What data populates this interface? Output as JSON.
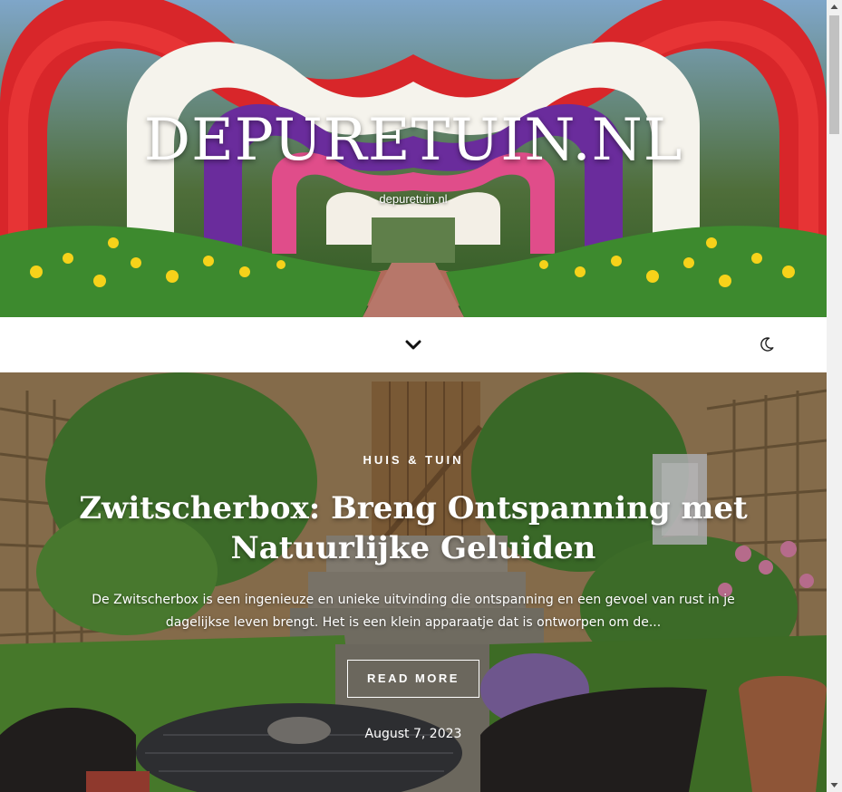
{
  "header": {
    "site_title": "DEPURETUIN.NL",
    "tagline": "depuretuin.nl"
  },
  "nav": {
    "menu_icon": "chevron-down-icon",
    "theme_icon": "moon-icon"
  },
  "featured_post": {
    "category": "HUIS & TUIN",
    "title": "Zwitscherbox: Breng Ontspanning met Natuurlijke Geluiden",
    "excerpt": "De Zwitscherbox is een ingenieuze en unieke uitvinding die ontspanning en een gevoel van rust in je dagelijkse leven brengt. Het is een klein apparaatje dat is ontworpen om de...",
    "read_more_label": "READ MORE",
    "date": "August 7, 2023"
  },
  "colors": {
    "header_bg": "#ffffff",
    "text_on_image": "#ffffff",
    "scrollbar_track": "#f1f1f1",
    "scrollbar_thumb": "#c1c1c1"
  }
}
